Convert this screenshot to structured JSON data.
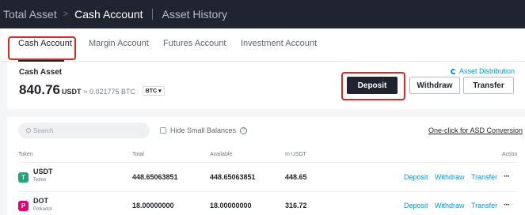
{
  "breadcrumb": {
    "root": "Total Asset",
    "separator": ">",
    "current": "Cash Account",
    "other": "Asset History"
  },
  "tabs": [
    {
      "label": "Cash Account",
      "active": true
    },
    {
      "label": "Margin Account",
      "active": false
    },
    {
      "label": "Futures Account",
      "active": false
    },
    {
      "label": "Investment Account",
      "active": false
    }
  ],
  "cash": {
    "title": "Cash Asset",
    "amount": "840.76",
    "unit": "USDT",
    "approx": "≈ 0.021775 BTC",
    "coin_select": "BTC",
    "asset_distribution": "Asset Distribution"
  },
  "actions": {
    "deposit": "Deposit",
    "withdraw": "Withdraw",
    "transfer": "Transfer"
  },
  "filters": {
    "search_placeholder": "Search",
    "hide_small": "Hide Small Balances",
    "help": "?",
    "asd_conversion": "One-click for ASD Conversion"
  },
  "table": {
    "headers": {
      "token": "Token",
      "total": "Total",
      "available": "Available",
      "in_usdt": "In USDT",
      "action": "Action"
    },
    "rows": [
      {
        "symbol": "USDT",
        "name": "Tether",
        "icon": "T",
        "icon_color": "#26a17b",
        "total": "448.65063851",
        "available": "448.65063851",
        "in_usdt": "448.65",
        "deposit": "Deposit",
        "withdraw": "Withdraw",
        "transfer": "Transfer",
        "more": "···"
      },
      {
        "symbol": "DOT",
        "name": "Polkadot",
        "icon": "P",
        "icon_color": "#e6007a",
        "total": "18.00000000",
        "available": "18.00000000",
        "in_usdt": "316.72",
        "deposit": "Deposit",
        "withdraw": "Withdraw",
        "transfer": "Transfer",
        "more": "···"
      }
    ]
  },
  "colors": {
    "accent_link": "#1a8fd6",
    "highlight_box": "#e0281e",
    "header_bg": "#1f2430"
  }
}
